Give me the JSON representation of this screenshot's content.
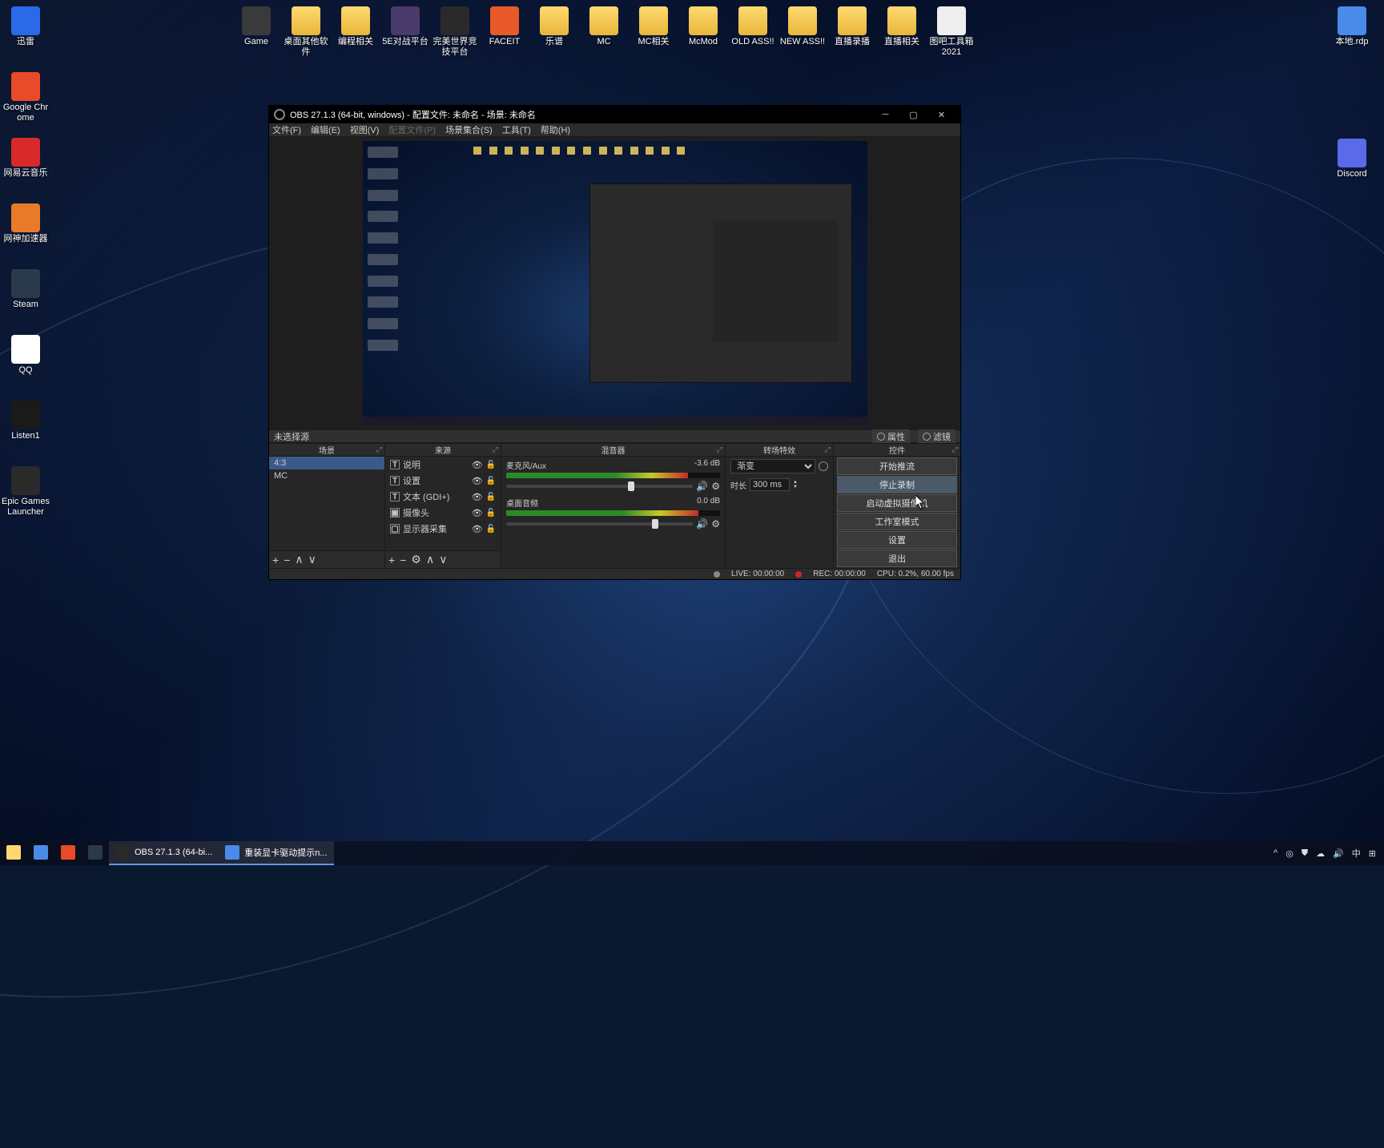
{
  "desktop_left": [
    {
      "label": "迅雷",
      "bg": "#2a6ae8"
    },
    {
      "label": "Google Chrome",
      "bg": "#e84a2a"
    },
    {
      "label": "网易云音乐",
      "bg": "#d82a2a"
    },
    {
      "label": "网神加速器",
      "bg": "#e87a2a"
    },
    {
      "label": "Steam",
      "bg": "#2a3a4a"
    },
    {
      "label": "QQ",
      "bg": "#fff"
    },
    {
      "label": "Listen1",
      "bg": "#1a1a1a"
    },
    {
      "label": "Epic Games Launcher",
      "bg": "#2a2a2a"
    }
  ],
  "desktop_top": [
    {
      "label": "Game",
      "folder": false,
      "bg": "#3a3a3a"
    },
    {
      "label": "桌面其他软件",
      "folder": true
    },
    {
      "label": "编程相关",
      "folder": true
    },
    {
      "label": "5E对战平台",
      "folder": false,
      "bg": "#4a3a6a"
    },
    {
      "label": "完美世界竞技平台",
      "folder": false,
      "bg": "#2a2a2a"
    },
    {
      "label": "FACEIT",
      "folder": false,
      "bg": "#e85a2a"
    },
    {
      "label": "乐谱",
      "folder": true
    },
    {
      "label": "MC",
      "folder": true
    },
    {
      "label": "MC相关",
      "folder": true
    },
    {
      "label": "McMod",
      "folder": true
    },
    {
      "label": "OLD ASS!!",
      "folder": true
    },
    {
      "label": "NEW ASS!!",
      "folder": true
    },
    {
      "label": "直播录播",
      "folder": true
    },
    {
      "label": "直播相关",
      "folder": true
    },
    {
      "label": "图吧工具箱2021",
      "folder": false,
      "bg": "#eee"
    }
  ],
  "desktop_right": [
    {
      "label": "本地.rdp",
      "bg": "#4a8ae8"
    },
    {
      "label": "Discord",
      "bg": "#5a6ae8"
    }
  ],
  "obs": {
    "title": "OBS 27.1.3 (64-bit, windows) - 配置文件: 未命名 - 场景: 未命名",
    "menu": [
      "文件(F)",
      "编辑(E)",
      "视图(V)",
      "配置文件(P)",
      "场景集合(S)",
      "工具(T)",
      "帮助(H)"
    ],
    "no_source": "未选择源",
    "props_btn": "属性",
    "filters_btn": "滤镜",
    "docks": {
      "scenes": {
        "title": "场景",
        "items": [
          "4:3",
          "MC"
        ]
      },
      "sources": {
        "title": "来源",
        "items": [
          {
            "icon": "T",
            "label": "说明"
          },
          {
            "icon": "T",
            "label": "设置"
          },
          {
            "icon": "T",
            "label": "文本 (GDI+)"
          },
          {
            "icon": "▣",
            "label": "摄像头"
          },
          {
            "icon": "▢",
            "label": "显示器采集"
          }
        ]
      },
      "mixer": {
        "title": "混音器",
        "channels": [
          {
            "name": "麦克风/Aux",
            "db": "-3.6 dB",
            "lvl": "85%",
            "thumb": "65%"
          },
          {
            "name": "桌面音频",
            "db": "0.0 dB",
            "lvl": "90%",
            "thumb": "78%"
          }
        ]
      },
      "trans": {
        "title": "转场特效",
        "type": "渐变",
        "dur_label": "时长",
        "dur": "300 ms"
      },
      "controls": {
        "title": "控件",
        "buttons": [
          "开始推流",
          "停止录制",
          "启动虚拟摄像机",
          "工作室模式",
          "设置",
          "退出"
        ]
      }
    },
    "status": {
      "live": "LIVE: 00:00:00",
      "rec": "REC: 00:00:00",
      "cpu": "CPU: 0.2%, 60.00 fps"
    }
  },
  "taskbar": {
    "items": [
      {
        "label": "",
        "bg": "#ffd970",
        "active": false
      },
      {
        "label": "",
        "bg": "#4a8ae8",
        "active": false
      },
      {
        "label": "",
        "bg": "#e84a2a",
        "active": false
      },
      {
        "label": "",
        "bg": "#2a3a4a",
        "active": false
      },
      {
        "label": "OBS 27.1.3 (64-bi...",
        "bg": "#2a2a2a",
        "active": true
      },
      {
        "label": "重装显卡驱动提示n...",
        "bg": "#4a8ae8",
        "active": true
      }
    ],
    "tray": [
      "^",
      "◎",
      "⛊",
      "☁",
      "🔊",
      "中",
      "⊞"
    ]
  }
}
